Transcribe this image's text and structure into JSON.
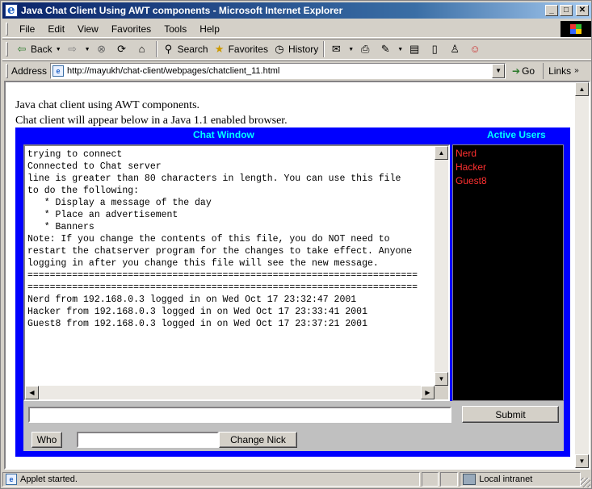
{
  "window": {
    "title": "Java Chat Client Using AWT components - Microsoft Internet Explorer",
    "controls": {
      "minimize": "_",
      "maximize": "□",
      "close": "✕"
    }
  },
  "menubar": {
    "items": [
      "File",
      "Edit",
      "View",
      "Favorites",
      "Tools",
      "Help"
    ]
  },
  "toolbar": {
    "back": "Back",
    "search": "Search",
    "favorites": "Favorites",
    "history": "History"
  },
  "addressbar": {
    "label": "Address",
    "url": "http://mayukh/chat-client/webpages/chatclient_11.html",
    "go": "Go",
    "links": "Links"
  },
  "page": {
    "intro_line1": "Java chat client using AWT components.",
    "intro_line2": "Chat client will appear below in a Java 1.1 enabled browser."
  },
  "applet": {
    "chat_header": "Chat Window",
    "users_header": "Active Users",
    "chat_lines": [
      "trying to connect",
      "Connected to Chat server",
      "line is greater than 80 characters in length. You can use this file",
      "to do the following:",
      "   * Display a message of the day",
      "   * Place an advertisement",
      "   * Banners",
      "Note: If you change the contents of this file, you do NOT need to",
      "restart the chatserver program for the changes to take effect. Anyone",
      "logging in after you change this file will see the new message.",
      "======================================================================",
      "======================================================================",
      "Nerd from 192.168.0.3 logged in on Wed Oct 17 23:32:47 2001",
      "Hacker from 192.168.0.3 logged in on Wed Oct 17 23:33:41 2001",
      "Guest8 from 192.168.0.3 logged in on Wed Oct 17 23:37:21 2001"
    ],
    "users": [
      "Nerd",
      "Hacker",
      "Guest8"
    ],
    "message_value": "",
    "submit": "Submit",
    "who": "Who",
    "nick_value": "",
    "change_nick": "Change Nick"
  },
  "statusbar": {
    "text": "Applet started.",
    "zone": "Local intranet"
  },
  "colors": {
    "applet_bg": "#0000ff",
    "header_text": "#00ffff",
    "user_text": "#ff3030",
    "titlebar": "#0a246a"
  }
}
